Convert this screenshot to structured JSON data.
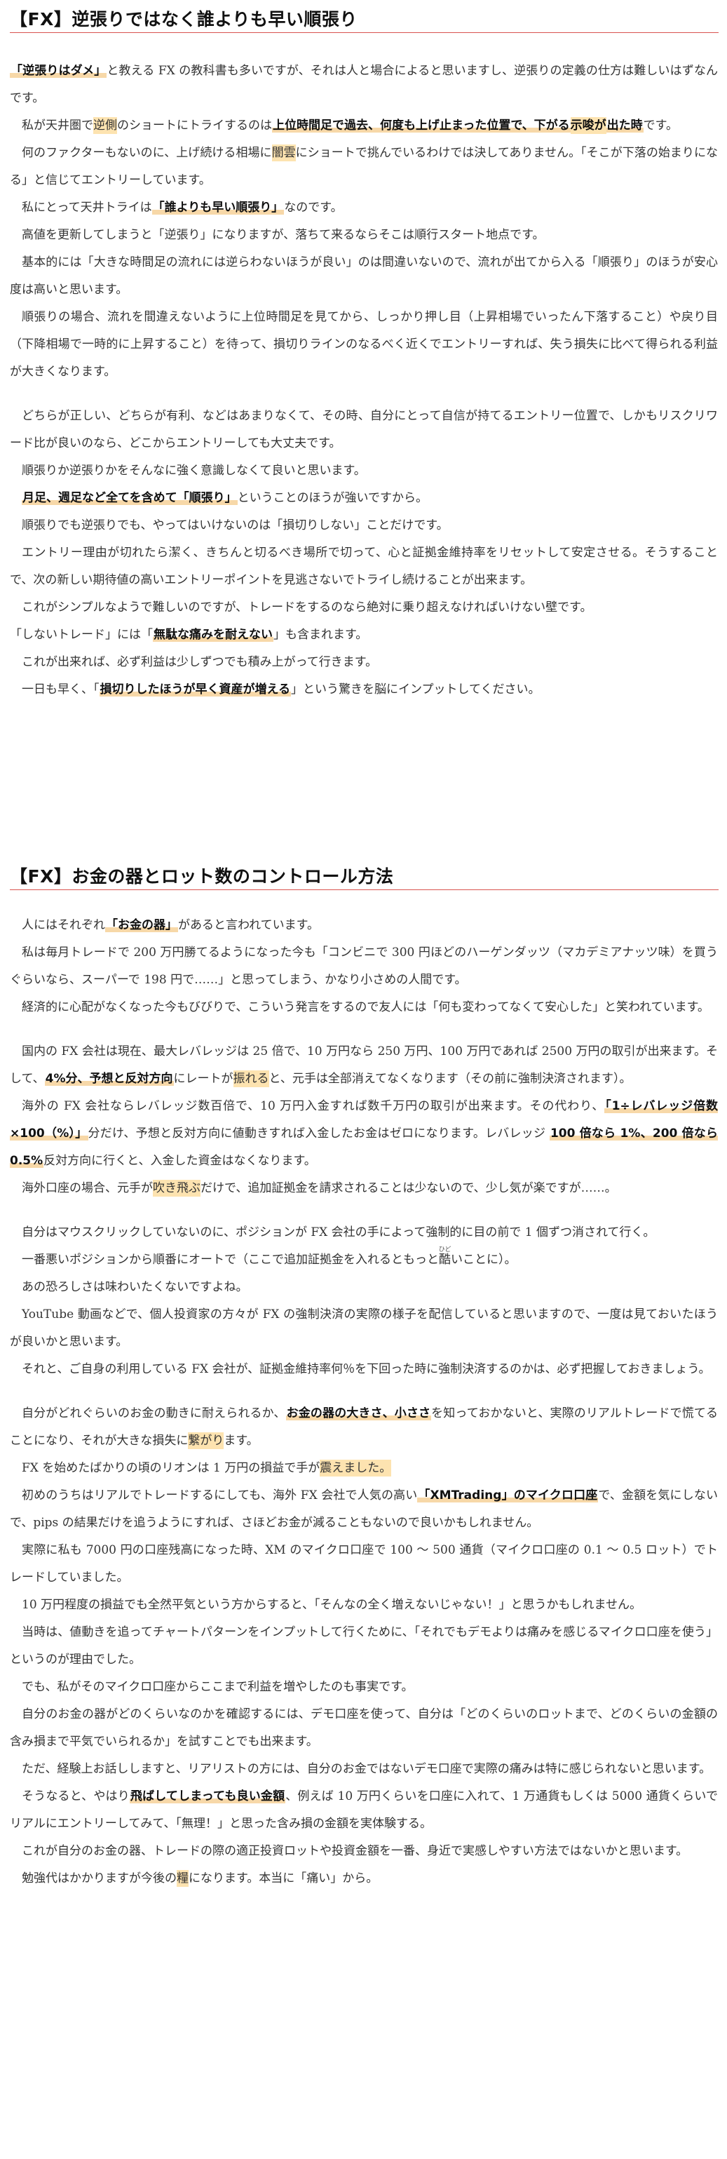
{
  "section1": {
    "title": "【FX】逆張りではなく誰よりも早い順張り",
    "p1": {
      "e1": "「逆張りはダメ」",
      "t1": "と教える FX の教科書も多いですが、それは人と場合によると思いますし、逆張りの定義の仕方は難しいはずなんです。"
    },
    "p2": {
      "t1": "私が天井圏で",
      "h1": "逆側",
      "t2": "のショートにトライするのは",
      "e1": "上位時間足で過去、何度も上げ止まった位置で、下がる",
      "h2": "示唆が",
      "e2": "出た時",
      "t3": "です。"
    },
    "p3": {
      "t1": "何のファクターもないのに、上げ続ける相場に",
      "h1": "闇雲",
      "t2": "にショートで挑んでいるわけでは決してありません。「そこが下落の始まりになる」と信じてエントリーしています。"
    },
    "p4": {
      "t1": "私にとって天井トライは",
      "e1": "「誰よりも早い順張り」",
      "t2": "なのです。"
    },
    "p5": "高値を更新してしまうと「逆張り」になりますが、落ちて来るならそこは順行スタート地点です。",
    "p6": "基本的には「大きな時間足の流れには逆らわないほうが良い」のは間違いないので、流れが出てから入る「順張り」のほうが安心度は高いと思います。",
    "p7": "順張りの場合、流れを間違えないように上位時間足を見てから、しっかり押し目（上昇相場でいったん下落すること）や戻り目（下降相場で一時的に上昇すること）を待って、損切りラインのなるべく近くでエントリーすれば、失う損失に比べて得られる利益が大きくなります。",
    "p8": "どちらが正しい、どちらが有利、などはあまりなくて、その時、自分にとって自信が持てるエントリー位置で、しかもリスクリワード比が良いのなら、どこからエントリーしても大丈夫です。",
    "p9": "順張りか逆張りかをそんなに強く意識しなくて良いと思います。",
    "p10": {
      "e1": "月足、週足など全てを含めて「順張り」",
      "t1": "ということのほうが強いですから。"
    },
    "p11": "順張りでも逆張りでも、やってはいけないのは「損切りしない」ことだけです。",
    "p12": "エントリー理由が切れたら潔く、きちんと切るべき場所で切って、心と証拠金維持率をリセットして安定させる。そうすることで、次の新しい期待値の高いエントリーポイントを見逃さないでトライし続けることが出来ます。",
    "p13": "これがシンプルなようで難しいのですが、トレードをするのなら絶対に乗り超えなければいけない壁です。",
    "p14": {
      "t1": "「しないトレード」には「",
      "e1": "無駄な痛みを耐えない",
      "t2": "」も含まれます。"
    },
    "p15": "これが出来れば、必ず利益は少しずつでも積み上がって行きます。",
    "p16": {
      "t1": "一日も早く、「",
      "e1": "損切りしたほうが早く資産が増える",
      "t2": "」という驚きを脳にインプットしてください。"
    }
  },
  "section2": {
    "title": "【FX】お金の器とロット数のコントロール方法",
    "q1": {
      "t1": "人にはそれぞれ",
      "e1": "「お金の器」",
      "t2": "があると言われています。"
    },
    "q2": "私は毎月トレードで 200 万円勝てるようになった今も「コンビニで 300 円ほどのハーゲンダッツ（マカデミアナッツ味）を買うぐらいなら、スーパーで 198 円で……」と思ってしまう、かなり小さめの人間です。",
    "q3": "経済的に心配がなくなった今もびびりで、こういう発言をするので友人には「何も変わってなくて安心した」と笑われています。",
    "q4": {
      "t1": "国内の FX 会社は現在、最大レバレッジは 25 倍で、10 万円なら 250 万円、100 万円であれば 2500 万円の取引が出来ます。そして、",
      "e1": "4%分、予想と反対方向",
      "t2": "にレートが",
      "h1": "振れる",
      "t3": "と、元手は全部消えてなくなります（その前に強制決済されます）。"
    },
    "q5": {
      "t1": "海外の FX 会社ならレバレッジ数百倍で、10 万円入金すれば数千万円の取引が出来ます。その代わり、",
      "e1": "「1÷レバレッジ倍数 ×100（%）」",
      "t2": "分だけ、予想と反対方向に値動きすれば入金したお金はゼロになります。レバレッジ ",
      "e2": "100 倍なら 1%、200 倍なら 0.5%",
      "t3": "反対方向に行くと、入金した資金はなくなります。"
    },
    "q6": {
      "t1": "海外口座の場合、元手が",
      "h1": "吹き飛ぶ",
      "t2": "だけで、追加証拠金を請求されることは少ないので、少し気が楽ですが……。"
    },
    "q7": "自分はマウスクリックしていないのに、ポジションが FX 会社の手によって強制的に目の前で 1 個ずつ消されて行く。",
    "q8": {
      "t1": "一番悪いポジションから順番にオートで（ここで追加証拠金を入れるともっと",
      "ruby": "酷",
      "rt": "ひど",
      "t2": "いことに）。"
    },
    "q9": "あの恐ろしさは味わいたくないですよね。",
    "q10": "YouTube 動画などで、個人投資家の方々が FX の強制決済の実際の様子を配信していると思いますので、一度は見ておいたほうが良いかと思います。",
    "q11": "それと、ご自身の利用している FX 会社が、証拠金維持率何％を下回った時に強制決済するのかは、必ず把握しておきましょう。",
    "q12": {
      "t1": "自分がどれぐらいのお金の動きに耐えられるか、",
      "e1": "お金の器の大きさ、小ささ",
      "t2": "を知っておかないと、実際のリアルトレードで慌てることになり、それが大きな損失に",
      "h1": "繋がり",
      "t3": "ます。"
    },
    "q13": {
      "t1": "FX を始めたばかりの頃のリオンは 1 万円の損益で手が",
      "h1": "震えました。"
    },
    "q14": {
      "t1": "初めのうちはリアルでトレードするにしても、海外 FX 会社で人気の高い",
      "e1": "「XMTrading」のマイクロ口座",
      "t2": "で、金額を気にしないで、pips の結果だけを追うようにすれば、さほどお金が減ることもないので良いかもしれません。"
    },
    "q15": "実際に私も 7000 円の口座残高になった時、XM のマイクロ口座で 100 ～ 500 通貨（マイクロ口座の 0.1 ～ 0.5 ロット）でトレードしていました。",
    "q16": "10 万円程度の損益でも全然平気という方からすると、「そんなの全く増えないじゃない！」と思うかもしれません。",
    "q17": "当時は、値動きを追ってチャートパターンをインプットして行くために、「それでもデモよりは痛みを感じるマイクロ口座を使う」というのが理由でした。",
    "q18": "でも、私がそのマイクロ口座からここまで利益を増やしたのも事実です。",
    "q19": "自分のお金の器がどのくらいなのかを確認するには、デモ口座を使って、自分は「どのくらいのロットまで、どのくらいの金額の含み損まで平気でいられるか」を試すことでも出来ます。",
    "q20": "ただ、経験上お話ししますと、リアリストの方には、自分のお金ではないデモ口座で実際の痛みは特に感じられないと思います。",
    "q21": {
      "t1": "そうなると、やはり",
      "e1": "飛ばしてしまっても良い金額",
      "t2": "、例えば 10 万円くらいを口座に入れて、1 万通貨もしくは 5000 通貨くらいでリアルにエントリーしてみて、「無理！」と思った含み損の金額を実体験する。"
    },
    "q22": "これが自分のお金の器、トレードの際の適正投資ロットや投資金額を一番、身近で実感しやすい方法ではないかと思います。",
    "q23": {
      "t1": "勉強代はかかりますが今後の",
      "h1": "糧",
      "t2": "になります。本当に「痛い」から。"
    }
  }
}
